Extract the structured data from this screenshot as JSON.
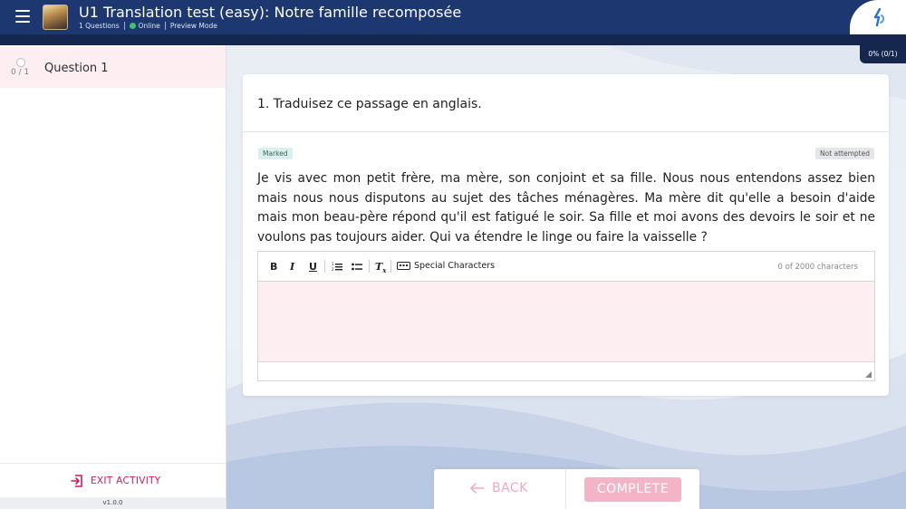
{
  "header": {
    "title": "U1 Translation test (easy): Notre famille recomposée",
    "questions_count": "1 Questions",
    "status": "Online",
    "mode": "Preview Mode",
    "progress": "0% (0/1)"
  },
  "sidebar": {
    "items": [
      {
        "score": "0 / 1",
        "label": "Question 1"
      }
    ],
    "exit_label": "EXIT ACTIVITY",
    "version": "v1.0.0"
  },
  "question": {
    "title": "1.  Traduisez ce passage en anglais.",
    "tag_marked": "Marked",
    "tag_status": "Not attempted",
    "passage": "Je vis avec mon petit frère, ma mère, son conjoint et sa fille. Nous nous entendons assez bien mais nous nous disputons au sujet des tâches ménagères. Ma mère dit qu'elle a besoin d'aide mais mon beau-père répond qu'il est fatigué le soir. Sa fille et moi avons des devoirs le soir et ne voulons pas toujours aider. Qui va étendre le linge ou faire la vaisselle ?"
  },
  "editor": {
    "bold": "B",
    "italic": "I",
    "underline": "U",
    "clear_format": "T",
    "special_chars": "Special Characters",
    "char_count": "0 of 2000 characters",
    "value": ""
  },
  "nav": {
    "back": "BACK",
    "complete": "COMPLETE"
  },
  "colors": {
    "header_bg": "#1d3870",
    "accent_pink": "#d0195e",
    "complete_bg": "#f4b4c8",
    "online_green": "#3cc36b"
  }
}
